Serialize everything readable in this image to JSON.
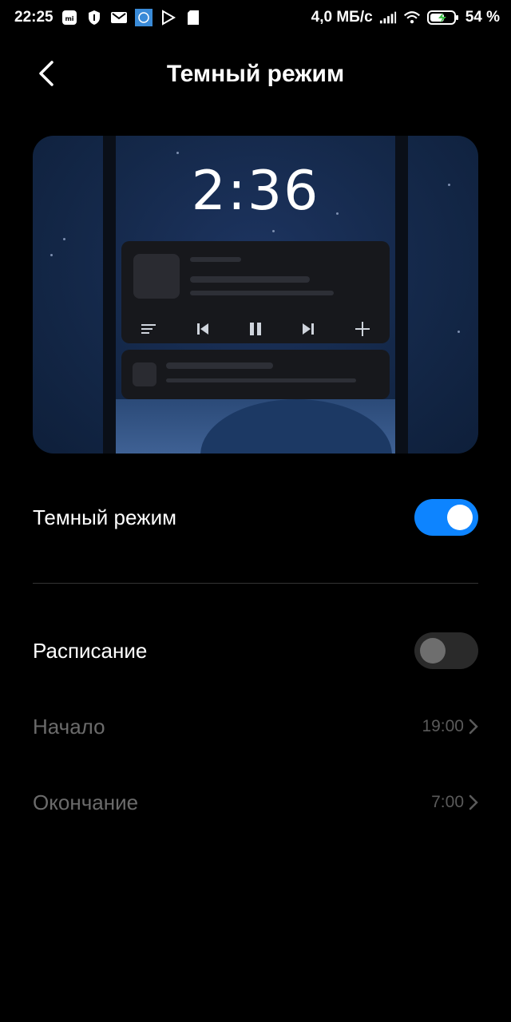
{
  "statusbar": {
    "time": "22:25",
    "network_speed": "4,0 МБ/с",
    "battery": "54 %",
    "left_icons": [
      "mi-icon",
      "shield-icon",
      "gmail-icon",
      "app-icon",
      "play-store-icon",
      "sd-card-icon"
    ]
  },
  "header": {
    "title": "Темный режим"
  },
  "preview": {
    "clock": "2:36"
  },
  "settings": {
    "dark_mode": {
      "label": "Темный режим",
      "enabled": true
    },
    "schedule": {
      "label": "Расписание",
      "enabled": false
    },
    "start": {
      "label": "Начало",
      "value": "19:00"
    },
    "end": {
      "label": "Окончание",
      "value": "7:00"
    }
  },
  "colors": {
    "accent": "#0d84ff",
    "background": "#000000"
  }
}
